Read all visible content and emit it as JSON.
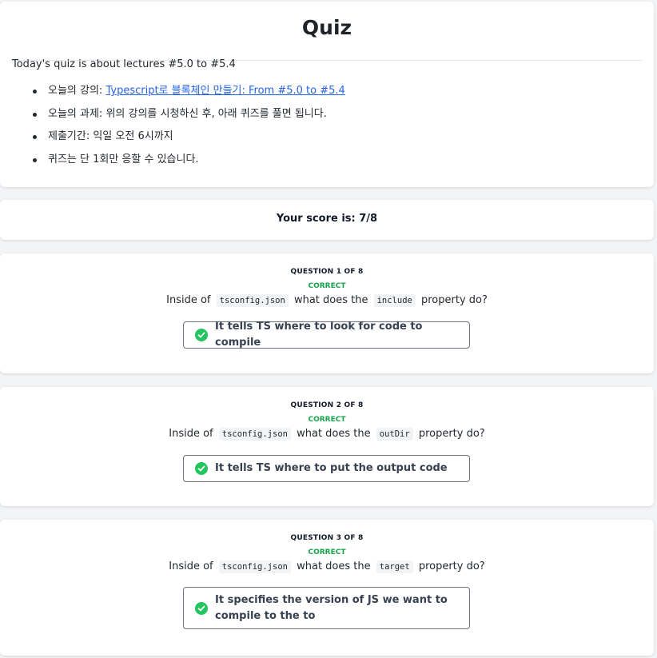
{
  "intro": {
    "title": "Quiz",
    "lead": "Today's quiz is about lectures #5.0 to #5.4",
    "items": [
      {
        "prefix": "오늘의 강의: ",
        "link": "Typescript로 블록체인 만들기: From #5.0 to #5.4"
      },
      {
        "prefix": "오늘의 과제: 위의 강의를 시청하신 후, 아래 퀴즈를 풀면 됩니다."
      },
      {
        "prefix": "제출기간: 익일 오전 6시까지"
      },
      {
        "prefix": "퀴즈는 단 1회만 응할 수 있습니다."
      }
    ]
  },
  "score": {
    "text": "Your score is: 7/8"
  },
  "questions": [
    {
      "label": "QUESTION 1 OF 8",
      "status": "CORRECT",
      "prompt_before": "Inside of",
      "code1": "tsconfig.json",
      "prompt_mid": "what does the",
      "code2": "include",
      "prompt_after": "property do?",
      "answer": "It tells TS where to look for code to compile"
    },
    {
      "label": "QUESTION 2 OF 8",
      "status": "CORRECT",
      "prompt_before": "Inside of",
      "code1": "tsconfig.json",
      "prompt_mid": "what does the",
      "code2": "outDir",
      "prompt_after": "property do?",
      "answer": "It tells TS where to put the output code"
    },
    {
      "label": "QUESTION 3 OF 8",
      "status": "CORRECT",
      "prompt_before": "Inside of",
      "code1": "tsconfig.json",
      "prompt_mid": "what does the",
      "code2": "target",
      "prompt_after": "property do?",
      "answer": "It specifies the version of JS we want to compile to the to"
    }
  ],
  "colors": {
    "correct": "#16a34a",
    "check": "#22c55e",
    "link": "#2563eb",
    "background": "#f3f4f6"
  },
  "icons": {
    "answer_status": "check-circle-icon"
  }
}
